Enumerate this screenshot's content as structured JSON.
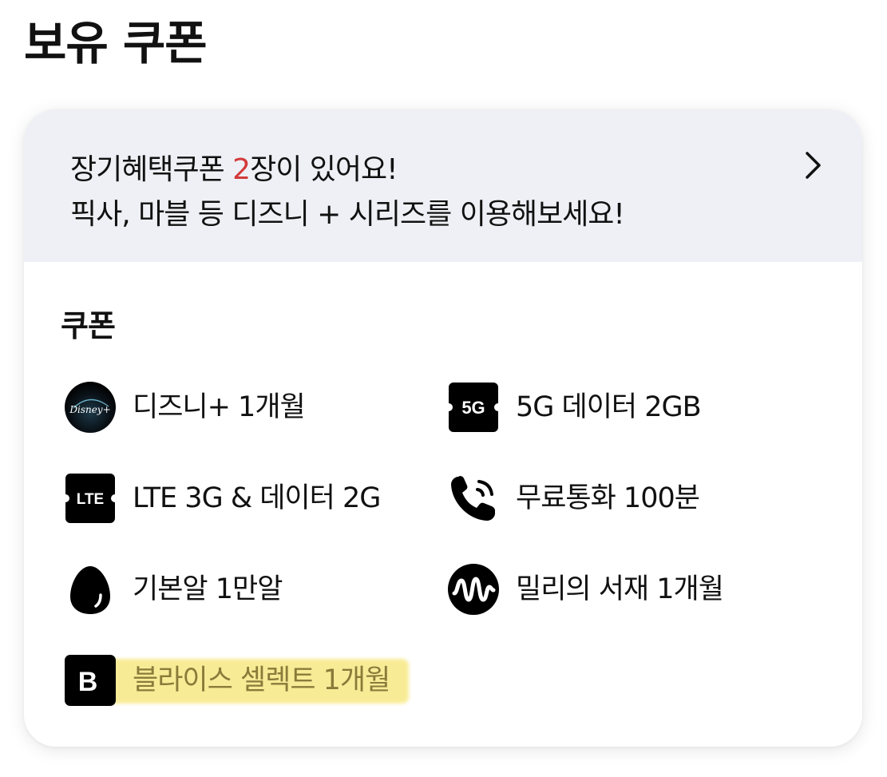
{
  "page": {
    "title": "보유 쿠폰"
  },
  "banner": {
    "line1_before": "장기혜택쿠폰 ",
    "line1_count": "2",
    "line1_after": "장이 있어요!",
    "line2": "픽사, 마블 등 디즈니 + 시리즈를 이용해보세요!",
    "count_color": "#d23a3a",
    "chevron_icon": "chevron-right-icon"
  },
  "coupons_section": {
    "title": "쿠폰",
    "items": [
      {
        "label": "디즈니+ 1개월",
        "icon": "disney-plus-logo-icon",
        "icon_text": "Disney+"
      },
      {
        "label": "5G 데이터 2GB",
        "icon": "5g-ticket-icon",
        "icon_text": "5G"
      },
      {
        "label": "LTE 3G & 데이터 2G",
        "icon": "lte-ticket-icon",
        "icon_text": "LTE"
      },
      {
        "label": "무료통화 100분",
        "icon": "phone-call-icon"
      },
      {
        "label": "기본알 1만알",
        "icon": "egg-icon"
      },
      {
        "label": "밀리의 서재 1개월",
        "icon": "millie-wave-logo-icon"
      },
      {
        "label": "블라이스 셀렉트 1개월",
        "icon": "blice-b-logo-icon",
        "icon_text": "B",
        "highlighted": true,
        "highlight_color": "#f7e77d"
      }
    ]
  }
}
